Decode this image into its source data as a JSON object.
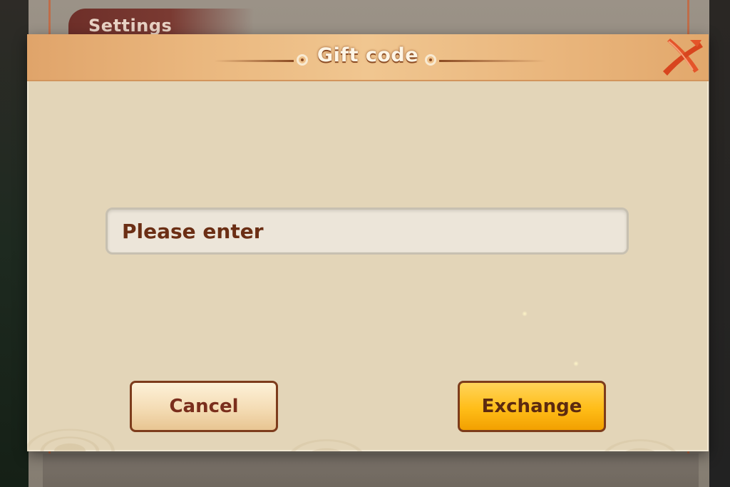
{
  "background": {
    "settings_label": "Settings"
  },
  "dialog": {
    "title": "Gift code",
    "input": {
      "value": "",
      "placeholder": "Please enter"
    },
    "buttons": {
      "cancel_label": "Cancel",
      "exchange_label": "Exchange"
    },
    "icons": {
      "close": "close-x-icon",
      "title_ornament": "knot-ornament-icon"
    }
  },
  "colors": {
    "title_bar": "#eab77e",
    "dialog_bg": "#e3d5b8",
    "text_brown": "#6b2e14",
    "exchange_button": "#ffbd18",
    "cancel_button": "#f4dcb4",
    "close_icon": "#e4552a"
  }
}
